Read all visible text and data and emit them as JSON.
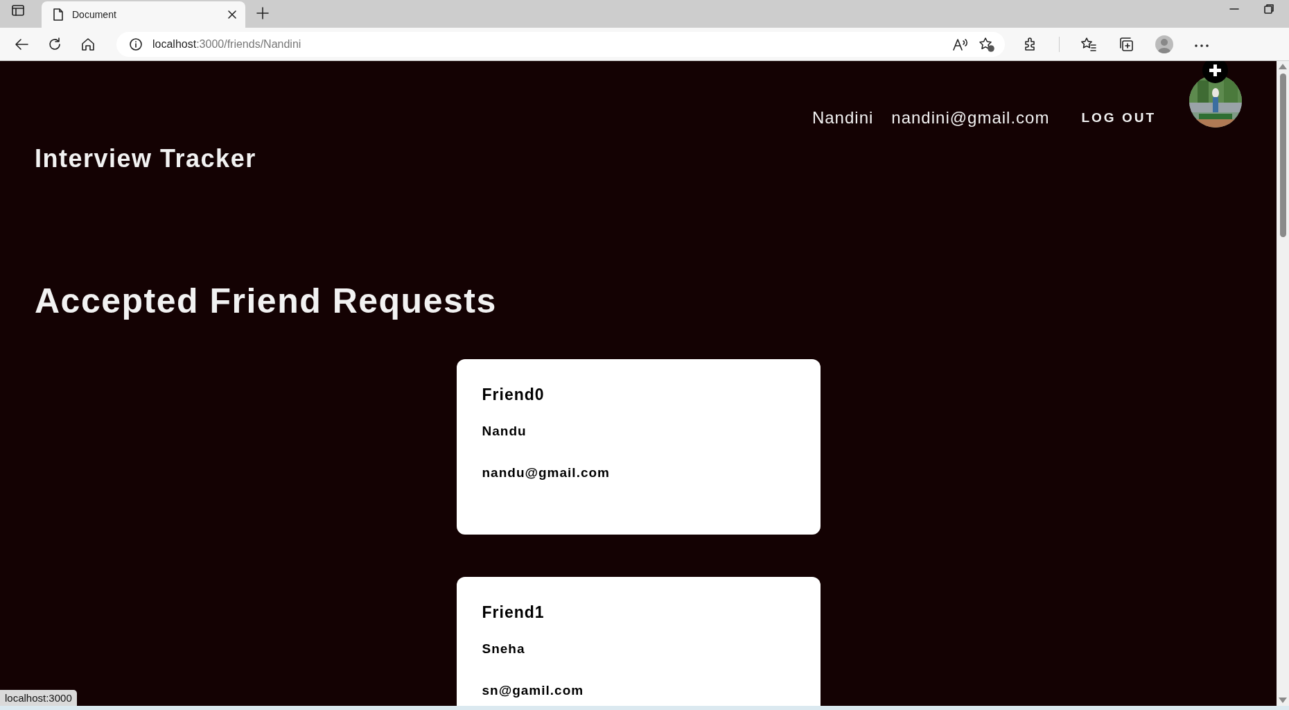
{
  "browser": {
    "tab_title": "Document",
    "address_host": "localhost",
    "address_rest": ":3000/friends/Nandini",
    "status": "localhost:3000"
  },
  "header": {
    "title": "Interview Tracker",
    "user_name": "Nandini",
    "user_email": "nandini@gmail.com",
    "logout": "LOG OUT"
  },
  "heading": "Accepted Friend Requests",
  "friends": [
    {
      "label": "Friend0",
      "name": "Nandu",
      "email": "nandu@gmail.com"
    },
    {
      "label": "Friend1",
      "name": "Sneha",
      "email": "sn@gamil.com"
    }
  ]
}
